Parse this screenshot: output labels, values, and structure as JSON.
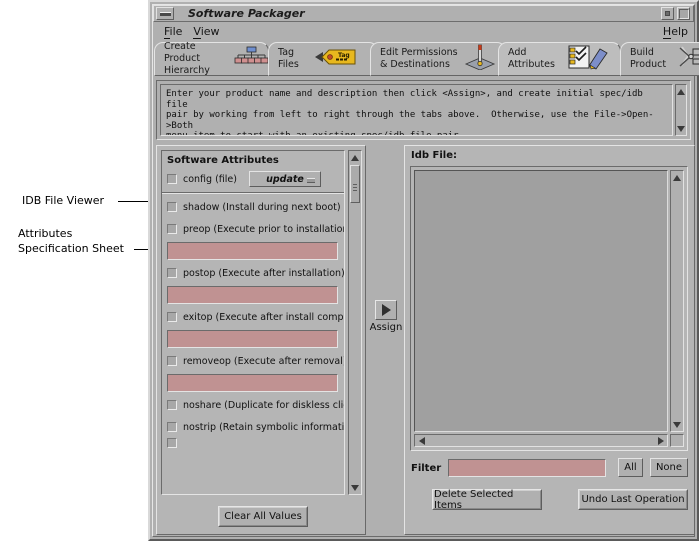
{
  "annotations": [
    {
      "text": "IDB File Viewer",
      "name": "annotation-idb-file-viewer"
    },
    {
      "text": "Attributes",
      "name": "annotation-attributes-line1"
    },
    {
      "text": "Specification Sheet",
      "name": "annotation-attributes-line2"
    }
  ],
  "window": {
    "title": "Software Packager",
    "menubar": {
      "file": "File",
      "view": "View",
      "help": "Help"
    },
    "titlebar_buttons": {
      "menu": "window-menu",
      "minimize": "minimize",
      "maximize": "maximize"
    }
  },
  "tabs": [
    {
      "label": "Create Product\nHierarchy",
      "icon": "hierarchy-icon",
      "selected": false
    },
    {
      "label": "Tag\nFiles",
      "icon": "tag-icon",
      "selected": false
    },
    {
      "label": "Edit  Permissions\n& Destinations",
      "icon": "permissions-icon",
      "selected": false
    },
    {
      "label": "Add\nAttributes",
      "icon": "attributes-icon",
      "selected": true
    },
    {
      "label": "Build\nProduct",
      "icon": "build-icon",
      "selected": false
    }
  ],
  "instructions": {
    "text": "Enter your product name and description then click <Assign>, and create initial spec/idb file\npair by working from left to right through the tabs above.  Otherwise, use the File->Open->Both\nmenu item to start with an existing spec/idb file pair."
  },
  "left_panel": {
    "title": "Software Attributes",
    "option_button": {
      "label": "update"
    },
    "rows": [
      {
        "key": "config",
        "label": "config  (file)",
        "has_button": true,
        "checked": false
      },
      {
        "key": "shadow",
        "label": "shadow  (Install during next boot)",
        "checked": false
      },
      {
        "key": "preop",
        "label": "preop  (Execute prior to installation)",
        "checked": false,
        "field": ""
      },
      {
        "key": "postop",
        "label": "postop  (Execute after installation)",
        "checked": false,
        "field": ""
      },
      {
        "key": "exitop",
        "label": "exitop  (Execute after install completed)",
        "checked": false,
        "field": ""
      },
      {
        "key": "removeop",
        "label": "removeop  (Execute after removal)",
        "checked": false,
        "field": ""
      },
      {
        "key": "noshare",
        "label": "noshare  (Duplicate for diskless clients)",
        "checked": false
      },
      {
        "key": "nostrip",
        "label": "nostrip  (Retain symbolic information)",
        "checked": false
      }
    ],
    "clear_button": "Clear All Values"
  },
  "right_panel": {
    "title": "Idb File:",
    "filter_label": "Filter",
    "filter_value": "",
    "all_button": "All",
    "none_button": "None",
    "delete_button": "Delete Selected Items",
    "undo_button": "Undo Last Operation"
  },
  "assign": {
    "label": "Assign",
    "icon": "play-arrow-icon"
  },
  "colors": {
    "face": "#b0b0b0",
    "field_pink": "#c09292",
    "canvas": "#a0a0a0",
    "shadow": "#5d5d5d",
    "highlight": "#e6e6e6",
    "tag_yellow": "#e8b81e"
  }
}
